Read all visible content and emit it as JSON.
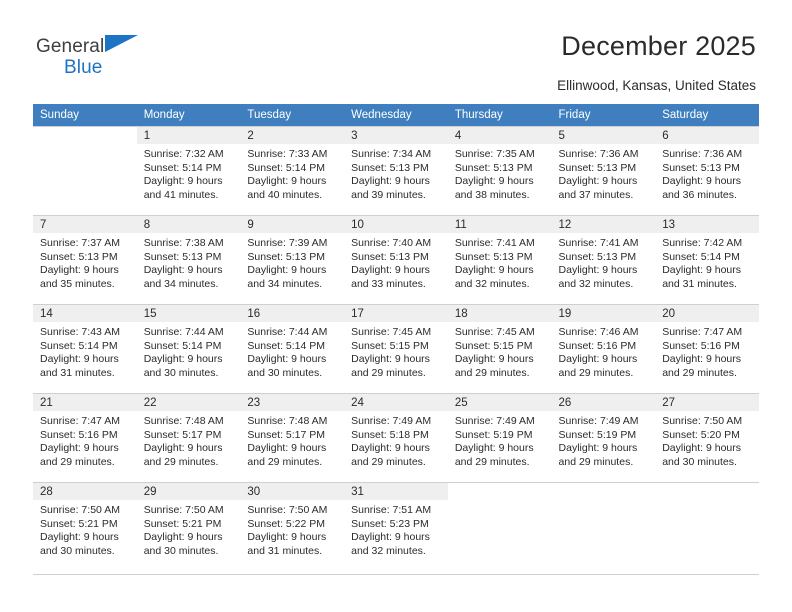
{
  "brand": {
    "line1": "General",
    "line2": "Blue",
    "flag_icon": "triangle-flag-icon",
    "flag_color": "#1c74c4"
  },
  "header": {
    "title": "December 2025",
    "subtitle": "Ellinwood, Kansas, United States"
  },
  "theme": {
    "header_bg": "#3f7fbf",
    "daynum_bg": "#efefef",
    "grid_line": "#cfcfcf",
    "text": "#2b2b2b"
  },
  "weekdays": [
    "Sunday",
    "Monday",
    "Tuesday",
    "Wednesday",
    "Thursday",
    "Friday",
    "Saturday"
  ],
  "weeks": [
    [
      {
        "day": "",
        "sunrise": "",
        "sunset": "",
        "daylight1": "",
        "daylight2": "",
        "blank": true
      },
      {
        "day": "1",
        "sunrise": "Sunrise: 7:32 AM",
        "sunset": "Sunset: 5:14 PM",
        "daylight1": "Daylight: 9 hours",
        "daylight2": "and 41 minutes."
      },
      {
        "day": "2",
        "sunrise": "Sunrise: 7:33 AM",
        "sunset": "Sunset: 5:14 PM",
        "daylight1": "Daylight: 9 hours",
        "daylight2": "and 40 minutes."
      },
      {
        "day": "3",
        "sunrise": "Sunrise: 7:34 AM",
        "sunset": "Sunset: 5:13 PM",
        "daylight1": "Daylight: 9 hours",
        "daylight2": "and 39 minutes."
      },
      {
        "day": "4",
        "sunrise": "Sunrise: 7:35 AM",
        "sunset": "Sunset: 5:13 PM",
        "daylight1": "Daylight: 9 hours",
        "daylight2": "and 38 minutes."
      },
      {
        "day": "5",
        "sunrise": "Sunrise: 7:36 AM",
        "sunset": "Sunset: 5:13 PM",
        "daylight1": "Daylight: 9 hours",
        "daylight2": "and 37 minutes."
      },
      {
        "day": "6",
        "sunrise": "Sunrise: 7:36 AM",
        "sunset": "Sunset: 5:13 PM",
        "daylight1": "Daylight: 9 hours",
        "daylight2": "and 36 minutes."
      }
    ],
    [
      {
        "day": "7",
        "sunrise": "Sunrise: 7:37 AM",
        "sunset": "Sunset: 5:13 PM",
        "daylight1": "Daylight: 9 hours",
        "daylight2": "and 35 minutes."
      },
      {
        "day": "8",
        "sunrise": "Sunrise: 7:38 AM",
        "sunset": "Sunset: 5:13 PM",
        "daylight1": "Daylight: 9 hours",
        "daylight2": "and 34 minutes."
      },
      {
        "day": "9",
        "sunrise": "Sunrise: 7:39 AM",
        "sunset": "Sunset: 5:13 PM",
        "daylight1": "Daylight: 9 hours",
        "daylight2": "and 34 minutes."
      },
      {
        "day": "10",
        "sunrise": "Sunrise: 7:40 AM",
        "sunset": "Sunset: 5:13 PM",
        "daylight1": "Daylight: 9 hours",
        "daylight2": "and 33 minutes."
      },
      {
        "day": "11",
        "sunrise": "Sunrise: 7:41 AM",
        "sunset": "Sunset: 5:13 PM",
        "daylight1": "Daylight: 9 hours",
        "daylight2": "and 32 minutes."
      },
      {
        "day": "12",
        "sunrise": "Sunrise: 7:41 AM",
        "sunset": "Sunset: 5:13 PM",
        "daylight1": "Daylight: 9 hours",
        "daylight2": "and 32 minutes."
      },
      {
        "day": "13",
        "sunrise": "Sunrise: 7:42 AM",
        "sunset": "Sunset: 5:14 PM",
        "daylight1": "Daylight: 9 hours",
        "daylight2": "and 31 minutes."
      }
    ],
    [
      {
        "day": "14",
        "sunrise": "Sunrise: 7:43 AM",
        "sunset": "Sunset: 5:14 PM",
        "daylight1": "Daylight: 9 hours",
        "daylight2": "and 31 minutes."
      },
      {
        "day": "15",
        "sunrise": "Sunrise: 7:44 AM",
        "sunset": "Sunset: 5:14 PM",
        "daylight1": "Daylight: 9 hours",
        "daylight2": "and 30 minutes."
      },
      {
        "day": "16",
        "sunrise": "Sunrise: 7:44 AM",
        "sunset": "Sunset: 5:14 PM",
        "daylight1": "Daylight: 9 hours",
        "daylight2": "and 30 minutes."
      },
      {
        "day": "17",
        "sunrise": "Sunrise: 7:45 AM",
        "sunset": "Sunset: 5:15 PM",
        "daylight1": "Daylight: 9 hours",
        "daylight2": "and 29 minutes."
      },
      {
        "day": "18",
        "sunrise": "Sunrise: 7:45 AM",
        "sunset": "Sunset: 5:15 PM",
        "daylight1": "Daylight: 9 hours",
        "daylight2": "and 29 minutes."
      },
      {
        "day": "19",
        "sunrise": "Sunrise: 7:46 AM",
        "sunset": "Sunset: 5:16 PM",
        "daylight1": "Daylight: 9 hours",
        "daylight2": "and 29 minutes."
      },
      {
        "day": "20",
        "sunrise": "Sunrise: 7:47 AM",
        "sunset": "Sunset: 5:16 PM",
        "daylight1": "Daylight: 9 hours",
        "daylight2": "and 29 minutes."
      }
    ],
    [
      {
        "day": "21",
        "sunrise": "Sunrise: 7:47 AM",
        "sunset": "Sunset: 5:16 PM",
        "daylight1": "Daylight: 9 hours",
        "daylight2": "and 29 minutes."
      },
      {
        "day": "22",
        "sunrise": "Sunrise: 7:48 AM",
        "sunset": "Sunset: 5:17 PM",
        "daylight1": "Daylight: 9 hours",
        "daylight2": "and 29 minutes."
      },
      {
        "day": "23",
        "sunrise": "Sunrise: 7:48 AM",
        "sunset": "Sunset: 5:17 PM",
        "daylight1": "Daylight: 9 hours",
        "daylight2": "and 29 minutes."
      },
      {
        "day": "24",
        "sunrise": "Sunrise: 7:49 AM",
        "sunset": "Sunset: 5:18 PM",
        "daylight1": "Daylight: 9 hours",
        "daylight2": "and 29 minutes."
      },
      {
        "day": "25",
        "sunrise": "Sunrise: 7:49 AM",
        "sunset": "Sunset: 5:19 PM",
        "daylight1": "Daylight: 9 hours",
        "daylight2": "and 29 minutes."
      },
      {
        "day": "26",
        "sunrise": "Sunrise: 7:49 AM",
        "sunset": "Sunset: 5:19 PM",
        "daylight1": "Daylight: 9 hours",
        "daylight2": "and 29 minutes."
      },
      {
        "day": "27",
        "sunrise": "Sunrise: 7:50 AM",
        "sunset": "Sunset: 5:20 PM",
        "daylight1": "Daylight: 9 hours",
        "daylight2": "and 30 minutes."
      }
    ],
    [
      {
        "day": "28",
        "sunrise": "Sunrise: 7:50 AM",
        "sunset": "Sunset: 5:21 PM",
        "daylight1": "Daylight: 9 hours",
        "daylight2": "and 30 minutes."
      },
      {
        "day": "29",
        "sunrise": "Sunrise: 7:50 AM",
        "sunset": "Sunset: 5:21 PM",
        "daylight1": "Daylight: 9 hours",
        "daylight2": "and 30 minutes."
      },
      {
        "day": "30",
        "sunrise": "Sunrise: 7:50 AM",
        "sunset": "Sunset: 5:22 PM",
        "daylight1": "Daylight: 9 hours",
        "daylight2": "and 31 minutes."
      },
      {
        "day": "31",
        "sunrise": "Sunrise: 7:51 AM",
        "sunset": "Sunset: 5:23 PM",
        "daylight1": "Daylight: 9 hours",
        "daylight2": "and 32 minutes."
      },
      {
        "day": "",
        "sunrise": "",
        "sunset": "",
        "daylight1": "",
        "daylight2": "",
        "blank": true
      },
      {
        "day": "",
        "sunrise": "",
        "sunset": "",
        "daylight1": "",
        "daylight2": "",
        "blank": true
      },
      {
        "day": "",
        "sunrise": "",
        "sunset": "",
        "daylight1": "",
        "daylight2": "",
        "blank": true
      }
    ]
  ]
}
